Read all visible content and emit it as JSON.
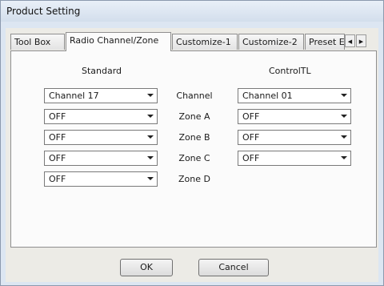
{
  "window": {
    "title": "Product Setting"
  },
  "tabs": [
    {
      "label": "Tool Box"
    },
    {
      "label": "Radio Channel/Zone"
    },
    {
      "label": "Customize-1"
    },
    {
      "label": "Customize-2"
    },
    {
      "label": "Preset E"
    }
  ],
  "active_tab": "Radio Channel/Zone",
  "columns": {
    "standard": "Standard",
    "control": "ControlTL"
  },
  "rows": [
    {
      "label": "Channel",
      "standard": "Channel 17",
      "control": "Channel 01"
    },
    {
      "label": "Zone A",
      "standard": "OFF",
      "control": "OFF"
    },
    {
      "label": "Zone B",
      "standard": "OFF",
      "control": "OFF"
    },
    {
      "label": "Zone C",
      "standard": "OFF",
      "control": "OFF"
    },
    {
      "label": "Zone D",
      "standard": "OFF"
    }
  ],
  "buttons": {
    "ok": "OK",
    "cancel": "Cancel"
  }
}
